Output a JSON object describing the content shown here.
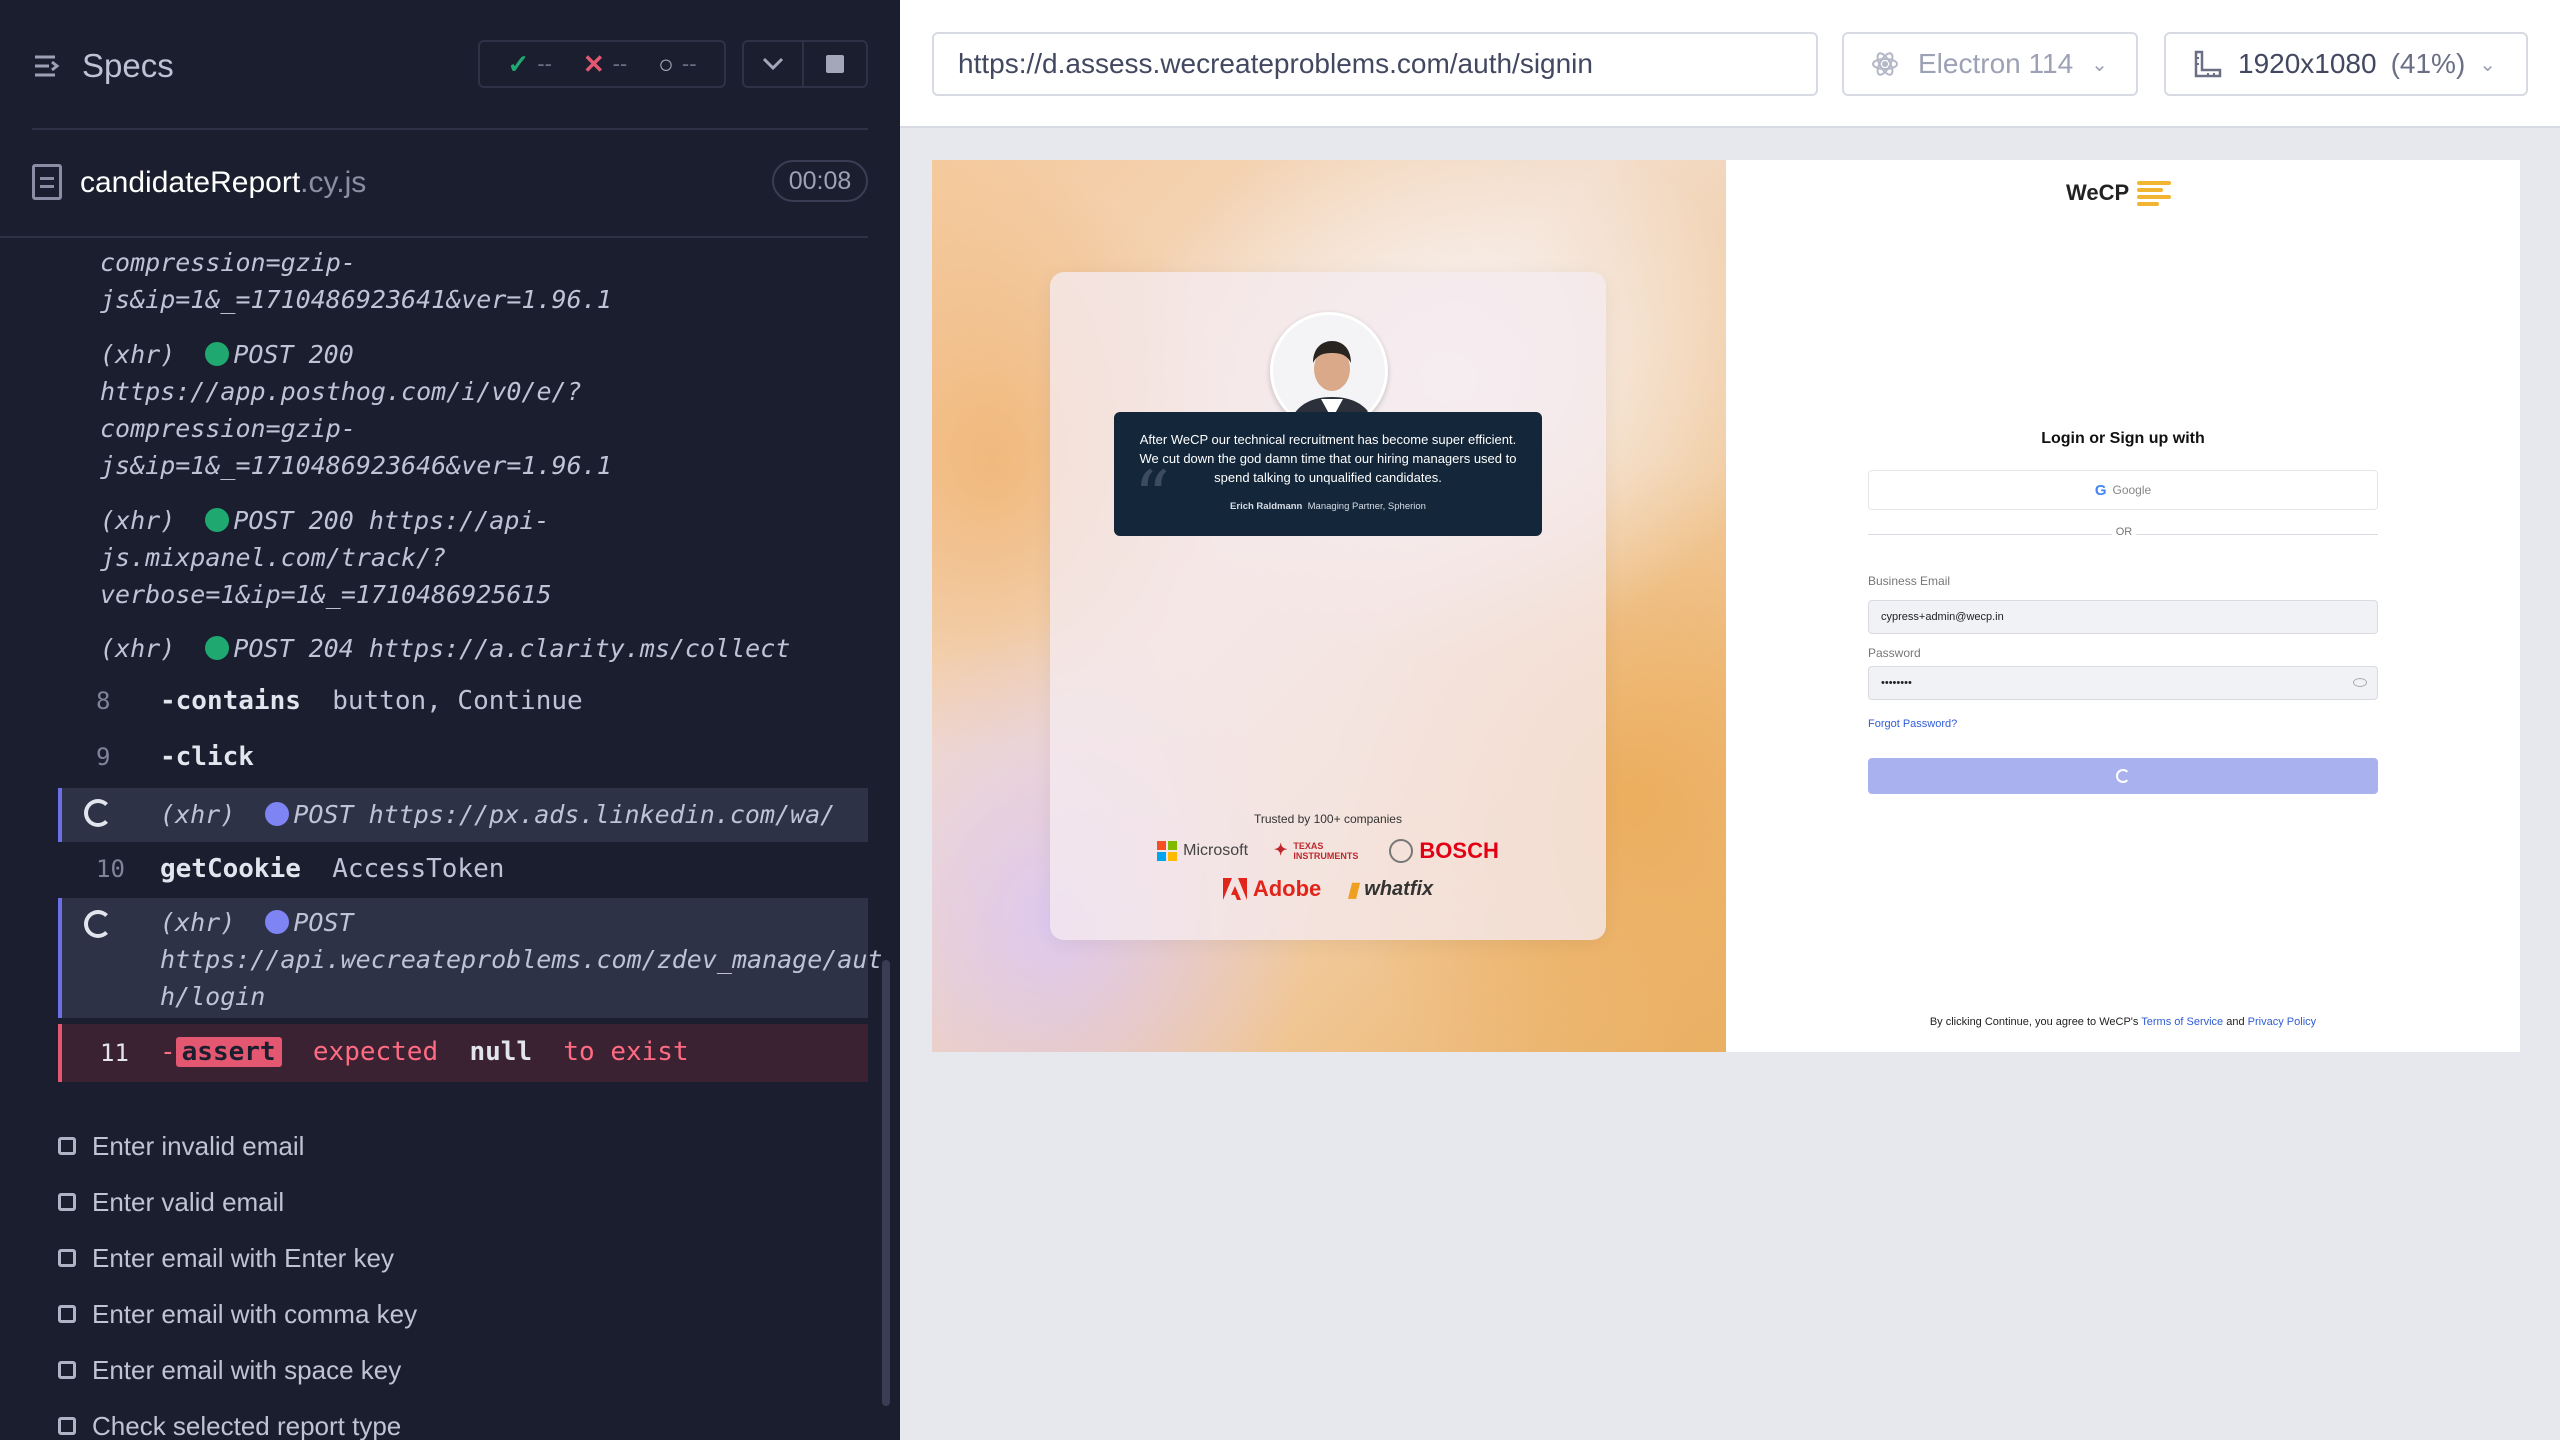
{
  "reporter": {
    "specs_label": "Specs",
    "stats": {
      "passed": "--",
      "failed": "--",
      "pending": "--"
    },
    "file": {
      "name": "candidateReport",
      "ext": ".cy.js",
      "duration": "00:08"
    },
    "logs": [
      {
        "lines": [
          "compression=gzip-",
          "js&ip=1&_=1710486923641&ver=1.96.1"
        ]
      },
      {
        "type": "(xhr)",
        "method": "POST 200",
        "lines": [
          "https://app.posthog.com/i/v0/e/?",
          "compression=gzip-",
          "js&ip=1&_=1710486923646&ver=1.96.1"
        ]
      },
      {
        "type": "(xhr)",
        "method": "POST 200",
        "first": "https://api-",
        "lines": [
          "js.mixpanel.com/track/?",
          "verbose=1&ip=1&_=1710486925615"
        ]
      },
      {
        "type": "(xhr)",
        "method": "POST 204",
        "first": "https://a.clarity.ms/collect"
      }
    ],
    "commands": [
      {
        "num": "8",
        "name": "-contains",
        "msg": "button, Continue"
      },
      {
        "num": "9",
        "name": "-click",
        "msg": ""
      },
      {
        "num": "",
        "name": "(xhr)",
        "msg": "POST https://px.ads.linkedin.com/wa/"
      },
      {
        "num": "10",
        "name": "getCookie",
        "msg": "AccessToken"
      },
      {
        "num": "",
        "name": "(xhr)",
        "msg": "POST",
        "lines": [
          "https://api.wecreateproblems.com/zdev_manage/aut",
          "h/login"
        ]
      },
      {
        "num": "11",
        "name": "-assert",
        "msg_parts": [
          "expected",
          "null",
          "to exist"
        ]
      }
    ],
    "tests": [
      "Enter invalid email",
      "Enter valid email",
      "Enter email with Enter key",
      "Enter email with comma key",
      "Enter email with space key",
      "Check selected report type"
    ]
  },
  "aut": {
    "url": "https://d.assess.wecreateproblems.com/auth/signin",
    "browser": "Electron 114",
    "viewport": "1920x1080",
    "scale": "(41%)"
  },
  "page": {
    "testimonial": {
      "quote": "After WeCP our technical recruitment has become super efficient. We cut down the god damn time that our hiring managers used to spend talking to unqualified candidates.",
      "author": "Erich Raldmann",
      "role": "Managing Partner, Spherion"
    },
    "trusted": "Trusted by 100+ companies",
    "logos": [
      "Microsoft",
      "Texas Instruments",
      "BOSCH",
      "Adobe",
      "whatfix"
    ],
    "brand": "WeCP",
    "login_title": "Login or Sign up with",
    "google_label": "Google",
    "or": "OR",
    "email_label": "Business Email",
    "email_value": "cypress+admin@wecp.in",
    "password_label": "Password",
    "password_value": "••••••••",
    "forgot": "Forgot Password?",
    "terms_prefix": "By clicking Continue, you agree to WeCP's",
    "terms_link": "Terms of Service",
    "terms_and": "and",
    "privacy_link": "Privacy Policy"
  }
}
